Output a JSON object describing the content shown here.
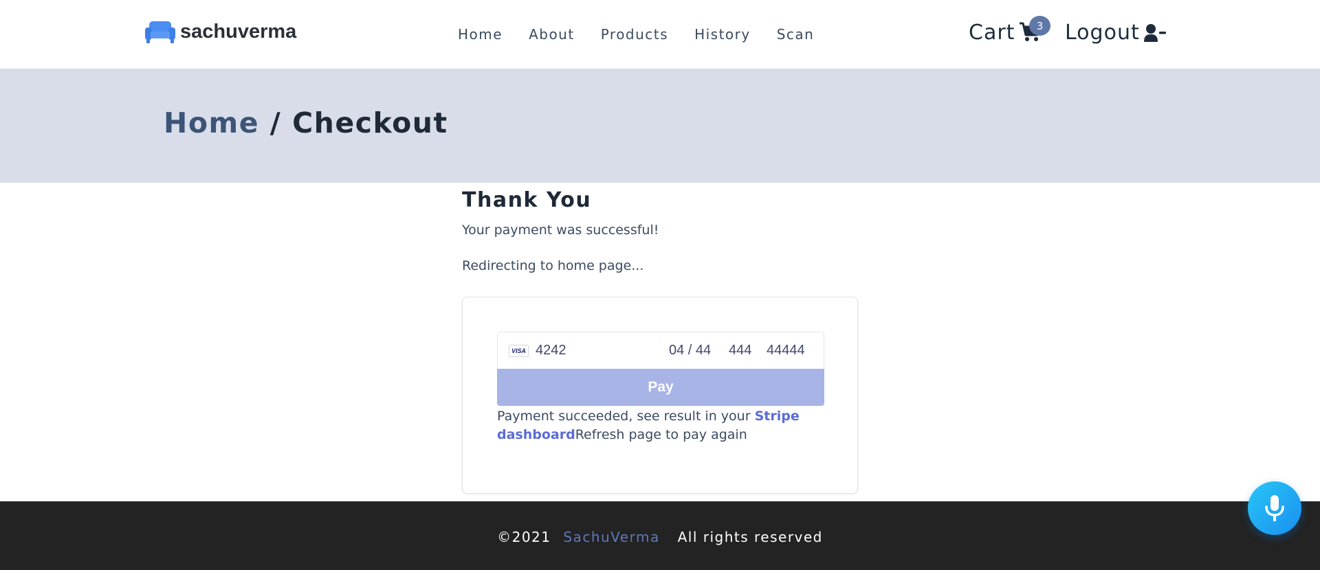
{
  "header": {
    "brand": "sachuverma",
    "brand_icon": "sofa-icon",
    "nav": [
      {
        "label": "Home"
      },
      {
        "label": "About"
      },
      {
        "label": "Products"
      },
      {
        "label": "History"
      },
      {
        "label": "Scan"
      }
    ],
    "cart_label": "Cart",
    "cart_icon": "shopping-cart-icon",
    "cart_count": "3",
    "logout_label": "Logout",
    "logout_icon": "user-minus-icon"
  },
  "breadcrumb": {
    "home": "Home",
    "separator": "/",
    "current": "Checkout"
  },
  "main": {
    "heading": "Thank You",
    "message": "Your payment was successful!",
    "redirect": "Redirecting to home page..."
  },
  "payment": {
    "card_brand": "VISA",
    "card_number": "4242",
    "expiry": "04 / 44",
    "cvc": "444",
    "zip": "44444",
    "pay_label": "Pay",
    "result_prefix": "Payment succeeded, see result in your ",
    "result_link": "Stripe dashboard",
    "result_suffix": "Refresh page to pay again"
  },
  "footer": {
    "copyright": "©2021",
    "brand": "SachuVerma",
    "rights": "All rights reserved"
  },
  "colors": {
    "banner_bg": "#d8dde9",
    "accent": "#5b6bd6",
    "pay_button": "#a8b3e6",
    "footer_bg": "#232323",
    "mic_button": "#1a8ff0"
  },
  "mic_icon": "microphone-icon"
}
